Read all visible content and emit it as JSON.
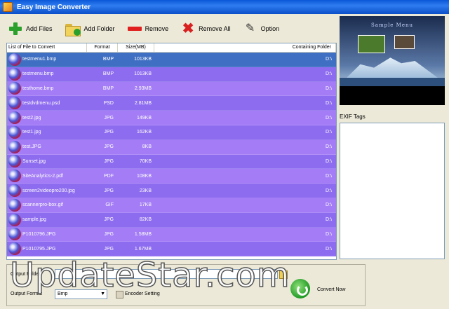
{
  "window": {
    "title": "Easy Image Converter"
  },
  "toolbar": {
    "add_files": "Add Files",
    "add_folder": "Add Folder",
    "remove": "Remove",
    "remove_all": "Remove All",
    "option": "Option"
  },
  "list": {
    "headers": {
      "name": "List of File to Convert",
      "format": "Format",
      "size": "Size(MB)",
      "folder": "Containing Folder"
    },
    "rows": [
      {
        "name": "testmenu1.bmp",
        "format": "BMP",
        "size": "1013KB",
        "folder": "D:\\",
        "selected": true
      },
      {
        "name": "testmenu.bmp",
        "format": "BMP",
        "size": "1013KB",
        "folder": "D:\\"
      },
      {
        "name": "testhome.bmp",
        "format": "BMP",
        "size": "2.93MB",
        "folder": "D:\\"
      },
      {
        "name": "testdvdmenu.psd",
        "format": "PSD",
        "size": "2.81MB",
        "folder": "D:\\"
      },
      {
        "name": "test2.jpg",
        "format": "JPG",
        "size": "149KB",
        "folder": "D:\\"
      },
      {
        "name": "test1.jpg",
        "format": "JPG",
        "size": "162KB",
        "folder": "D:\\"
      },
      {
        "name": "test.JPG",
        "format": "JPG",
        "size": "8KB",
        "folder": "D:\\"
      },
      {
        "name": "Sunset.jpg",
        "format": "JPG",
        "size": "70KB",
        "folder": "D:\\"
      },
      {
        "name": "SiteAnalytics-2.pdf",
        "format": "PDF",
        "size": "108KB",
        "folder": "D:\\"
      },
      {
        "name": "screen2videopro200.jpg",
        "format": "JPG",
        "size": "23KB",
        "folder": "D:\\"
      },
      {
        "name": "scannerpro-box.gif",
        "format": "GIF",
        "size": "17KB",
        "folder": "D:\\"
      },
      {
        "name": "sample.jpg",
        "format": "JPG",
        "size": "82KB",
        "folder": "D:\\"
      },
      {
        "name": "P1010796.JPG",
        "format": "JPG",
        "size": "1.58MB",
        "folder": "D:\\"
      },
      {
        "name": "P1010795.JPG",
        "format": "JPG",
        "size": "1.67MB",
        "folder": "D:\\"
      }
    ]
  },
  "preview": {
    "menu_title": "Sample Menu"
  },
  "exif": {
    "label": "EXIF Tags"
  },
  "output": {
    "folder_label": "Output Folder",
    "folder_value": "",
    "format_label": "Output Format",
    "format_value": "Bmp",
    "encoder_label": "Encoder Setting",
    "convert_label": "Convert Now"
  },
  "watermark": "UpdateStar.com",
  "colors": {
    "title_bar": "#0a58d8",
    "row_selected": "#3f6fc2",
    "row_even": "#8e6cf0",
    "row_odd": "#a37cf6"
  }
}
